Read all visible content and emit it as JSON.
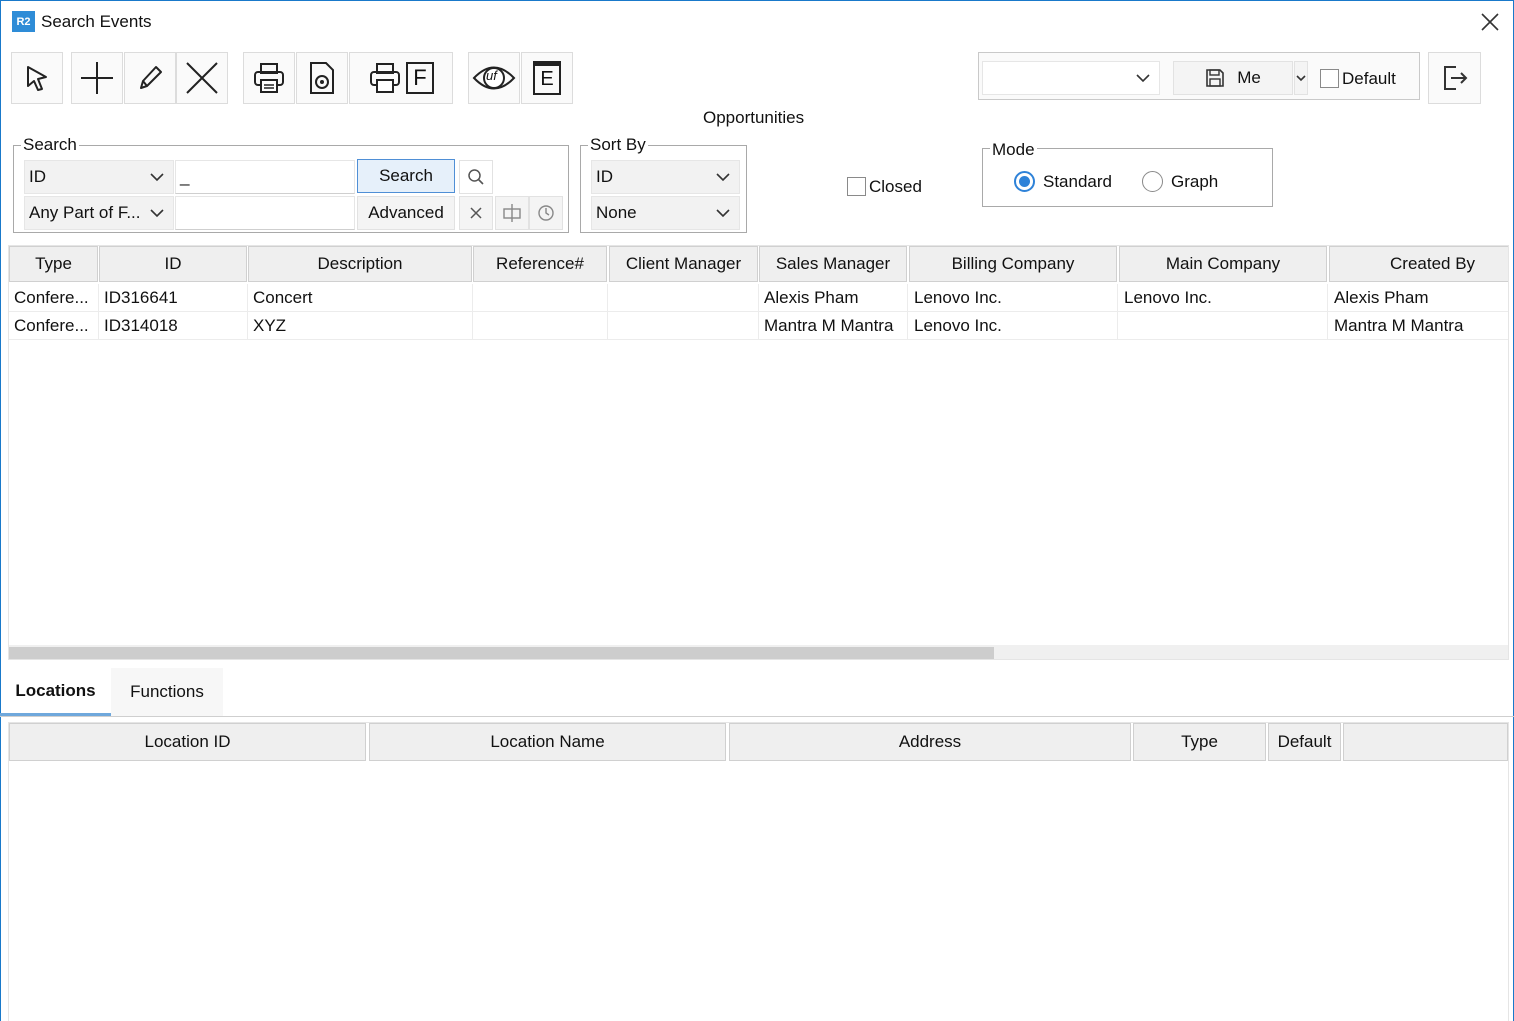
{
  "window": {
    "logo": "R2",
    "title": "Search Events"
  },
  "toolbar": {
    "format_letter": "F",
    "e_letter": "E",
    "uf_label": "uf"
  },
  "view_bar": {
    "view_combo_value": "",
    "save_label": "Me",
    "default_label": "Default"
  },
  "heading": "Opportunities",
  "search": {
    "legend": "Search",
    "field_value": "ID",
    "match_value": "Any Part of F...",
    "text_value": "_",
    "text2_value": "",
    "search_button": "Search",
    "advanced_button": "Advanced"
  },
  "sort": {
    "legend": "Sort By",
    "primary_value": "ID",
    "secondary_value": "None"
  },
  "closed_label": "Closed",
  "mode": {
    "legend": "Mode",
    "standard_label": "Standard",
    "graph_label": "Graph",
    "selected": "Standard"
  },
  "events_table": {
    "columns": [
      "Type",
      "ID",
      "Description",
      "Reference#",
      "Client Manager",
      "Sales Manager",
      "Billing Company",
      "Main Company",
      "Created By"
    ],
    "rows": [
      [
        "Confere...",
        "ID316641",
        "Concert",
        "",
        "",
        "Alexis  Pham",
        "Lenovo Inc.",
        "Lenovo Inc.",
        "Alexis Pham"
      ],
      [
        "Confere...",
        "ID314018",
        "XYZ",
        "",
        "",
        "Mantra M Mantra",
        "Lenovo Inc.",
        "",
        "Mantra M Mantra"
      ]
    ]
  },
  "tabs": [
    {
      "label": "Locations",
      "active": true
    },
    {
      "label": "Functions",
      "active": false
    }
  ],
  "locations_table": {
    "columns": [
      "Location ID",
      "Location Name",
      "Address",
      "Type",
      "Default"
    ],
    "rows": []
  },
  "colors": {
    "accent": "#2e82d8",
    "logo_bg": "#2e8cd7",
    "header_bg": "#efefef"
  }
}
